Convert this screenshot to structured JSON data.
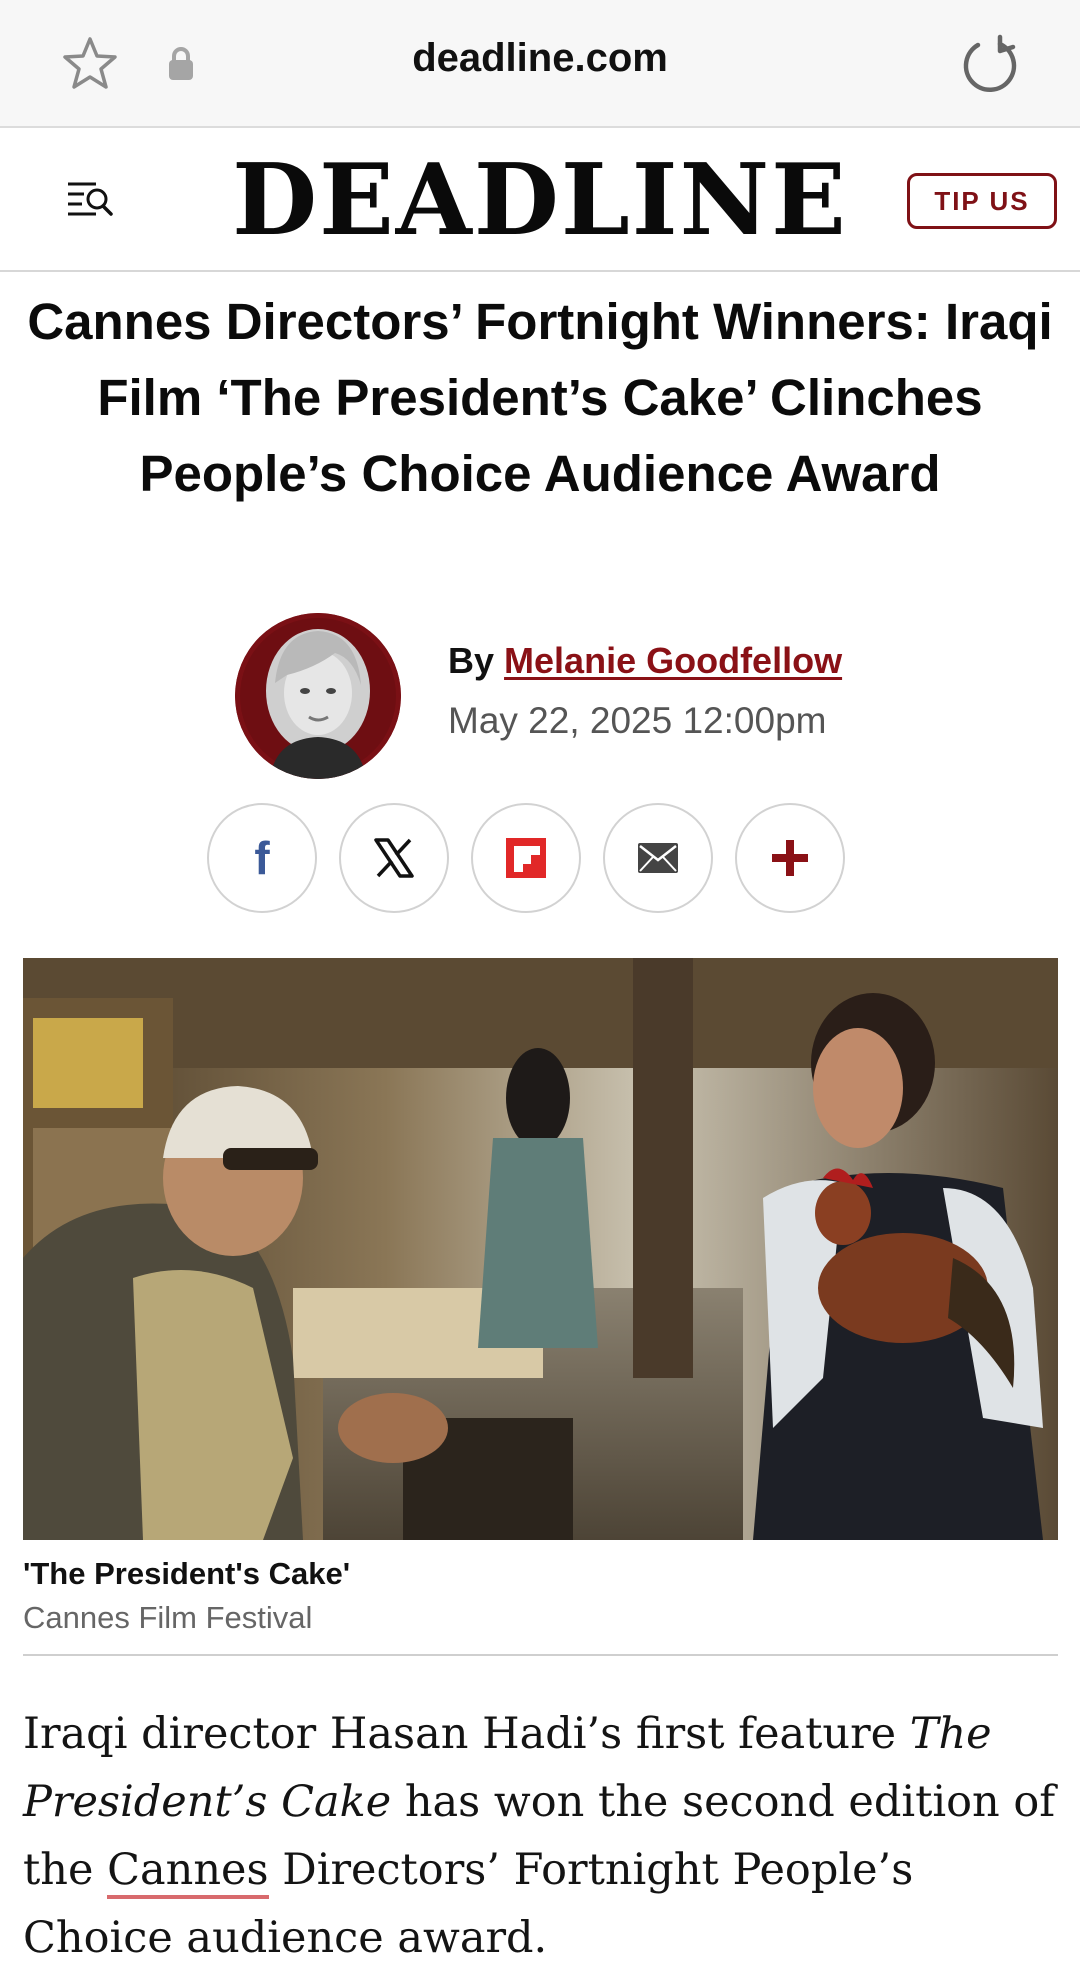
{
  "browser": {
    "url": "deadline.com"
  },
  "header": {
    "logo_text": "DEADLINE",
    "tip_label": "TIP US"
  },
  "article": {
    "headline": "Cannes Directors’ Fortnight Winners: Iraqi Film ‘The President’s Cake’ Clinches People’s Choice Audience Award",
    "byline_prefix": "By",
    "author": "Melanie Goodfellow",
    "date": "May 22, 2025 12:00pm",
    "share": {
      "facebook": "f",
      "x": "X",
      "flipboard": "flipboard",
      "email": "email",
      "more": "+"
    },
    "photo_caption_title": "'The President's Cake'",
    "photo_credit": "Cannes Film Festival",
    "body": {
      "p1_a": "Iraqi director Hasan Hadi’s first feature ",
      "p1_title": "The President’s Cake",
      "p1_b": " has won the second edition of the ",
      "p1_link": "Cannes",
      "p1_c": " Directors’ Fortnight People’s Choice audience award."
    }
  },
  "colors": {
    "brand_red": "#7f1116",
    "link_underline": "#d86a6d"
  },
  "icons": {
    "bookmark": "star-icon",
    "security": "lock-icon",
    "reload": "reload-icon",
    "menu": "menu-search-icon"
  }
}
